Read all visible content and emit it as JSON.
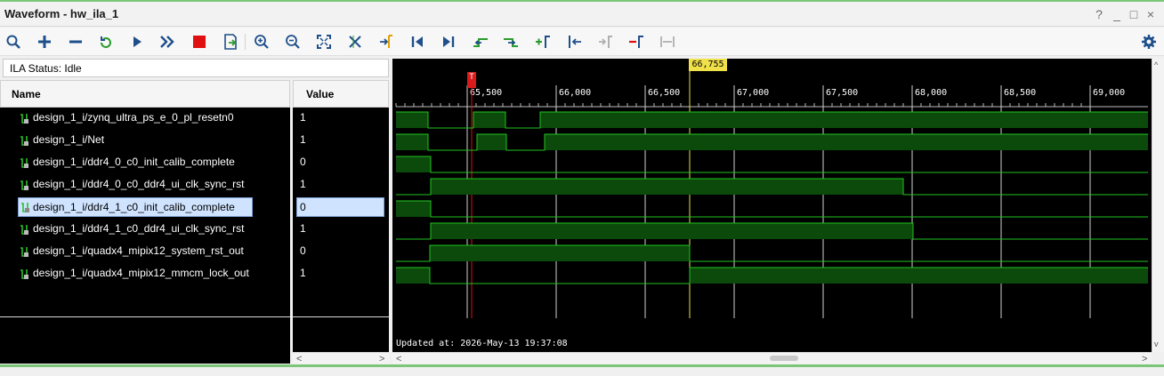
{
  "window": {
    "title": "Waveform - hw_ila_1",
    "controls": [
      "?",
      "_",
      "□",
      "×"
    ]
  },
  "toolbar": {
    "icons": [
      "search-icon",
      "zoom-plus-icon",
      "zoom-minus-icon",
      "refresh-icon",
      "run-icon",
      "run-all-icon",
      "stop-icon",
      "export-icon",
      "zoom-in-icon",
      "zoom-out-icon",
      "zoom-fit-icon",
      "cross-icon",
      "goto-cursor-icon",
      "go-start-icon",
      "go-end-icon",
      "prev-transition-icon",
      "next-transition-icon",
      "add-marker-icon",
      "prev-marker-icon",
      "next-marker-icon",
      "swap-icon",
      "expand-icon",
      "settings-icon"
    ]
  },
  "status": {
    "text": "ILA Status: Idle"
  },
  "panel": {
    "name_header": "Name",
    "value_header": "Value"
  },
  "signals": [
    {
      "name": "design_1_i/zynq_ultra_ps_e_0_pl_resetn0",
      "value": "1"
    },
    {
      "name": "design_1_i/Net",
      "value": "1"
    },
    {
      "name": "design_1_i/ddr4_0_c0_init_calib_complete",
      "value": "0"
    },
    {
      "name": "design_1_i/ddr4_0_c0_ddr4_ui_clk_sync_rst",
      "value": "1"
    },
    {
      "name": "design_1_i/ddr4_1_c0_init_calib_complete",
      "value": "0"
    },
    {
      "name": "design_1_i/ddr4_1_c0_ddr4_ui_clk_sync_rst",
      "value": "1"
    },
    {
      "name": "design_1_i/quadx4_mipix12_system_rst_out",
      "value": "0"
    },
    {
      "name": "design_1_i/quadx4_mipix12_mmcm_lock_out",
      "value": "1"
    }
  ],
  "waveform": {
    "marker_label": "66,755",
    "trigger_label": "T",
    "ticks": [
      "65,500",
      "66,000",
      "66,500",
      "67,000",
      "67,500",
      "68,000",
      "68,500",
      "69,000"
    ],
    "updated": "Updated at: 2026-May-13 19:37:08",
    "colors": {
      "wave": "#1fc41f",
      "high_fill": "#0c4a0c",
      "grid": "#d0d0d0",
      "marker": "#e8e050",
      "trigger": "#e01010"
    }
  }
}
